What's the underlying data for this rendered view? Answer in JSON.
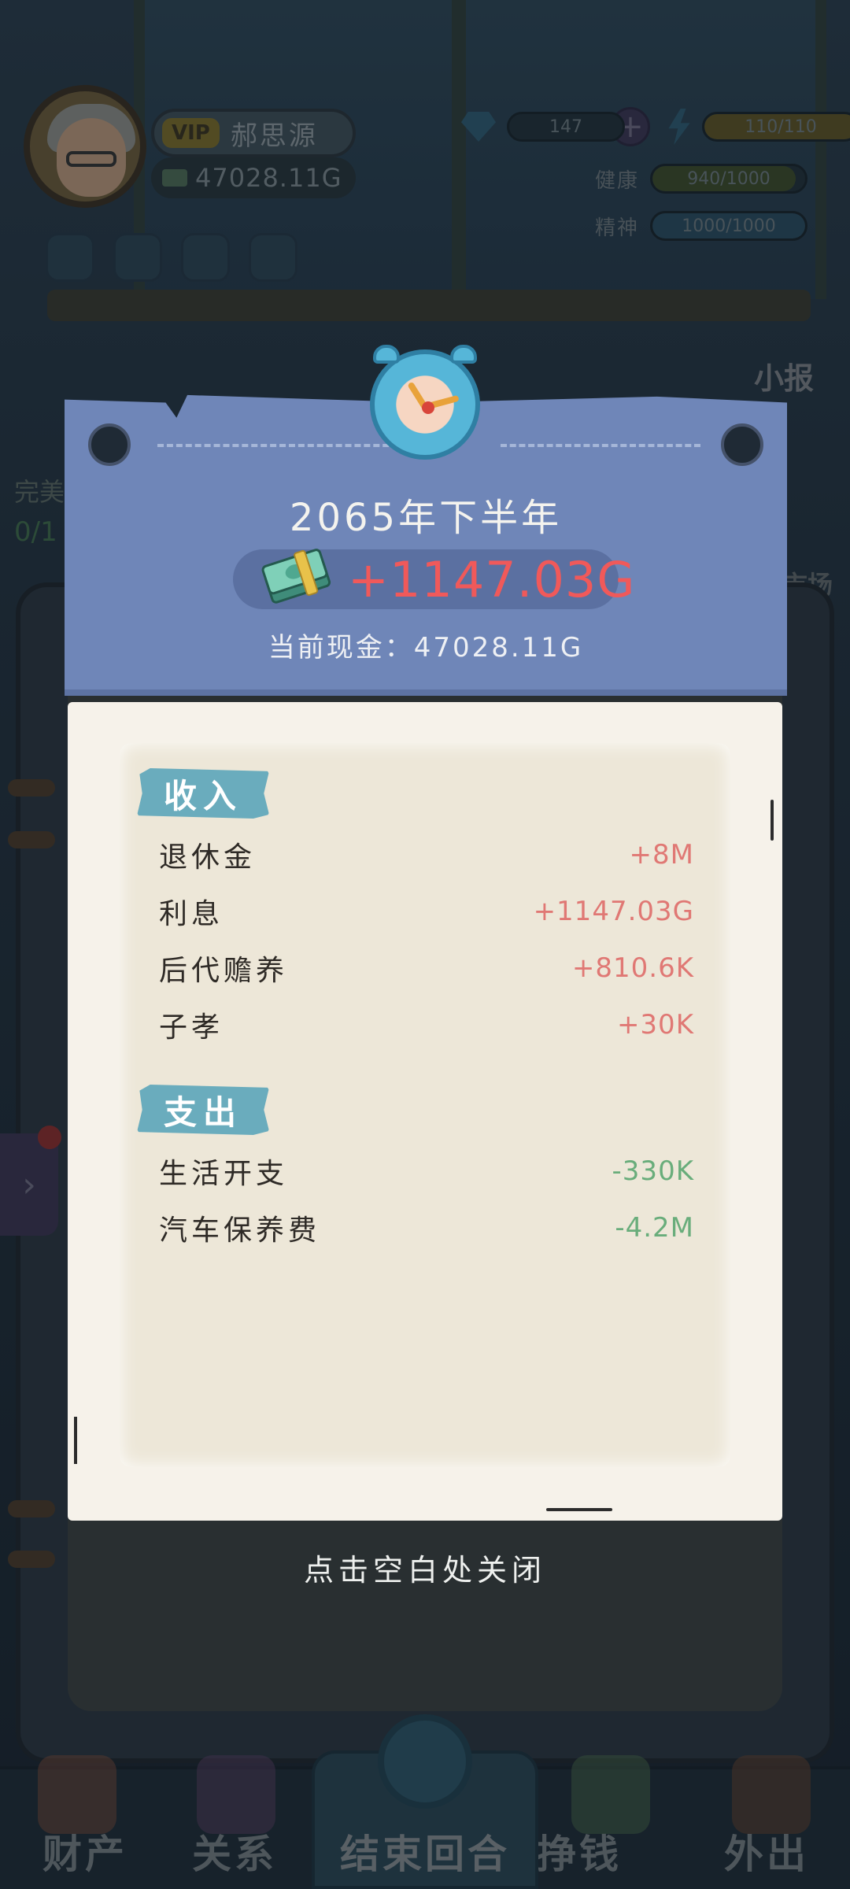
{
  "player": {
    "vip_label": "VIP",
    "name": "郝思源",
    "cash": "47028.11G"
  },
  "stats": {
    "diamonds": "147",
    "energy": "110/110",
    "energy_fraction": 1.0,
    "health_label": "健康",
    "health": "940/1000",
    "health_fraction": 0.94,
    "spirit_label": "精神",
    "spirit": "1000/1000",
    "spirit_fraction": 1.0
  },
  "background": {
    "news_label": "小报",
    "side_label": "完美",
    "side_count": "0/1",
    "field_label": "市场"
  },
  "popup": {
    "period": "2065年下半年",
    "gain": "+1147.03G",
    "current_cash": "当前现金：47028.11G",
    "income_title": "收入",
    "income": [
      {
        "label": "退休金",
        "value": "+8M"
      },
      {
        "label": "利息",
        "value": "+1147.03G"
      },
      {
        "label": "后代赡养",
        "value": "+810.6K"
      },
      {
        "label": "子孝",
        "value": "+30K"
      }
    ],
    "expense_title": "支出",
    "expense": [
      {
        "label": "生活开支",
        "value": "-330K"
      },
      {
        "label": "汽车保养费",
        "value": "-4.2M"
      }
    ],
    "close_hint": "点击空白处关闭"
  },
  "nav": {
    "assets": "财产",
    "relations": "关系",
    "end_turn": "结束回合",
    "earn": "挣钱",
    "go_out": "外出"
  },
  "colors": {
    "popup_header": "#6f86b8",
    "gain_red": "#f0595a",
    "income_red": "#e07874",
    "expense_green": "#69ad7b",
    "section_tag": "#6aacbd",
    "paper": "#ede7d8"
  }
}
